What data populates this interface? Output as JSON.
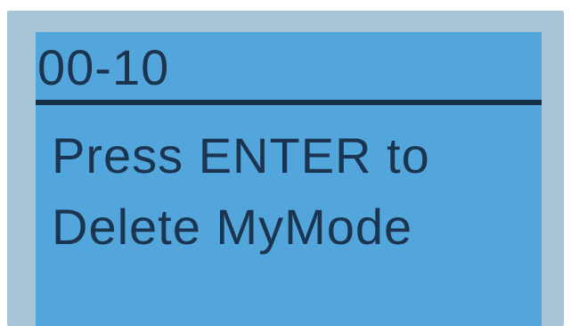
{
  "display": {
    "param_code": "00-10",
    "message_line_1": "Press ENTER to",
    "message_line_2": "Delete MyMode"
  },
  "colors": {
    "bezel": "#a7c3d6",
    "screen_background": "#53a6dc",
    "text": "#1b3550",
    "divider": "#163049"
  }
}
